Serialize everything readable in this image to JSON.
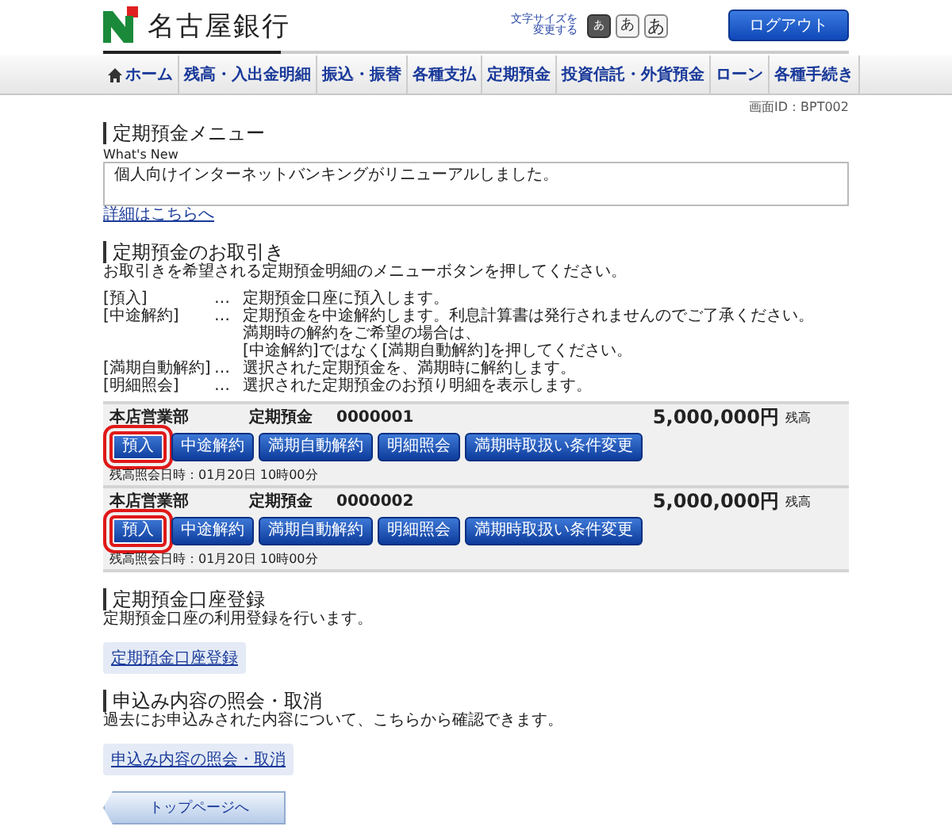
{
  "header": {
    "bank_name": "名古屋銀行",
    "font_size_label": [
      "文字サイズを",
      "変更する"
    ],
    "font_size_buttons": [
      {
        "label": "あ",
        "selected": true
      },
      {
        "label": "あ",
        "selected": false
      },
      {
        "label": "あ",
        "selected": false
      }
    ],
    "logout": "ログアウト"
  },
  "nav": [
    {
      "label": "ホーム",
      "kind": "home"
    },
    {
      "label": "残高・入出金明細",
      "kind": "text"
    },
    {
      "label": "振込・振替",
      "kind": "text"
    },
    {
      "label": "各種支払",
      "kind": "text"
    },
    {
      "label": "定期預金",
      "kind": "text"
    },
    {
      "label": "投資信託・外貨預金",
      "kind": "text"
    },
    {
      "label": "ローン",
      "kind": "text"
    },
    {
      "label": "各種手続き",
      "kind": "text"
    }
  ],
  "screen_id": "画面ID：BPT002",
  "page_title": "定期預金メニュー",
  "whats_new": {
    "label": "What's New",
    "message": "個人向けインターネットバンキングがリニューアルしました。",
    "link": "詳細はこちらへ"
  },
  "transactions": {
    "title": "定期預金のお取引き",
    "description": "お取引きを希望される定期預金明細のメニューボタンを押してください。",
    "legend": [
      {
        "term": "[預入]",
        "sep": "…",
        "text": [
          "定期預金口座に預入します。"
        ]
      },
      {
        "term": "[中途解約]",
        "sep": "…",
        "text": [
          "定期預金を中途解約します。利息計算書は発行されませんのでご了承ください。",
          "満期時の解約をご希望の場合は、",
          "[中途解約]ではなく[満期自動解約]を押してください。"
        ]
      },
      {
        "term": "[満期自動解約]",
        "sep": "…",
        "text": [
          "選択された定期預金を、満期時に解約します。"
        ]
      },
      {
        "term": "[明細照会]",
        "sep": "…",
        "text": [
          "選択された定期預金のお預り明細を表示します。"
        ]
      }
    ],
    "accounts": [
      {
        "branch": "本店営業部",
        "type": "定期預金",
        "number": "0000001",
        "amount": "5,000,000円",
        "amount_label": "残高",
        "buttons": [
          {
            "label": "預入",
            "highlighted": true
          },
          {
            "label": "中途解約",
            "highlighted": false
          },
          {
            "label": "満期自動解約",
            "highlighted": false
          },
          {
            "label": "明細照会",
            "highlighted": false
          },
          {
            "label": "満期時取扱い条件変更",
            "highlighted": false
          }
        ],
        "timestamp": "残高照会日時：01月20日 10時00分"
      },
      {
        "branch": "本店営業部",
        "type": "定期預金",
        "number": "0000002",
        "amount": "5,000,000円",
        "amount_label": "残高",
        "buttons": [
          {
            "label": "預入",
            "highlighted": true
          },
          {
            "label": "中途解約",
            "highlighted": false
          },
          {
            "label": "満期自動解約",
            "highlighted": false
          },
          {
            "label": "明細照会",
            "highlighted": false
          },
          {
            "label": "満期時取扱い条件変更",
            "highlighted": false
          }
        ],
        "timestamp": "残高照会日時：01月20日 10時00分"
      }
    ]
  },
  "sections": [
    {
      "title": "定期預金口座登録",
      "description": "定期預金口座の利用登録を行います。",
      "link": "定期預金口座登録"
    },
    {
      "title": "申込み内容の照会・取消",
      "description": "過去にお申込みされた内容について、こちらから確認できます。",
      "link": "申込み内容の照会・取消"
    }
  ],
  "top_page_button": "トップページへ"
}
